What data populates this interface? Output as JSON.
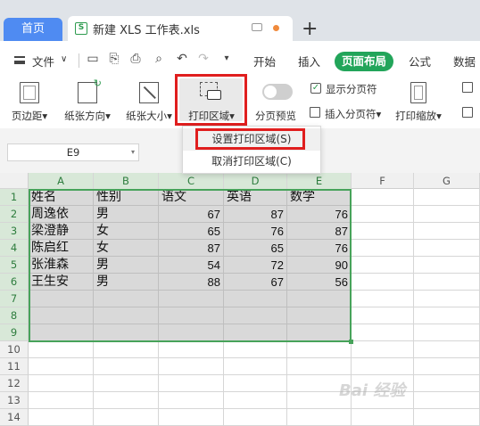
{
  "tabs": {
    "home": "首页",
    "document": "新建 XLS 工作表.xls",
    "doc_icon": "S",
    "new_tab": "+"
  },
  "menu": {
    "file": "文件",
    "file_caret": "∨",
    "items": [
      "开始",
      "插入",
      "页面布局",
      "公式",
      "数据"
    ],
    "active": "页面布局"
  },
  "ribbon": {
    "margins": "页边距",
    "orientation": "纸张方向",
    "paper_size": "纸张大小",
    "print_area": "打印区域",
    "page_break_preview": "分页预览",
    "show_page_breaks": "显示分页符",
    "insert_page_break": "插入分页符",
    "print_scale": "打印缩放",
    "caret": "▾"
  },
  "dropdown": {
    "set_print_area": "设置打印区域(S)",
    "cancel_print_area": "取消打印区域(C)"
  },
  "formula_bar": {
    "cell_ref": "E9"
  },
  "sheet": {
    "columns": [
      "A",
      "B",
      "C",
      "D",
      "E",
      "F",
      "G"
    ],
    "rows": [
      "1",
      "2",
      "3",
      "4",
      "5",
      "6",
      "7",
      "8",
      "9",
      "10",
      "11",
      "12",
      "13",
      "14"
    ],
    "data": [
      [
        "姓名",
        "性别",
        "语文",
        "英语",
        "数学"
      ],
      [
        "周逸依",
        "男",
        "67",
        "87",
        "76"
      ],
      [
        "梁澄静",
        "女",
        "65",
        "76",
        "87"
      ],
      [
        "陈启红",
        "女",
        "87",
        "65",
        "76"
      ],
      [
        "张淮森",
        "男",
        "54",
        "72",
        "90"
      ],
      [
        " 王生安",
        "男",
        "88",
        "67",
        "56"
      ]
    ]
  },
  "watermark": "Bai 经验",
  "colors": {
    "accent_green": "#22a55a",
    "home_tab_blue": "#4f8bf2",
    "highlight_red": "#e01e1e",
    "selection_green": "#47a35a"
  }
}
